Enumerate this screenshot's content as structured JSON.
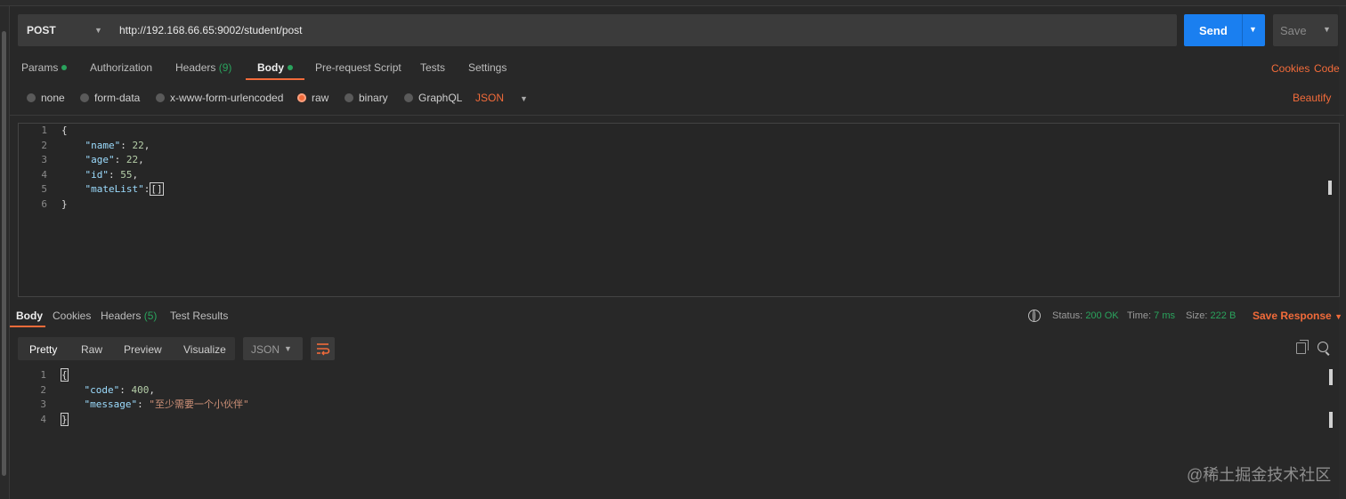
{
  "request": {
    "method": "POST",
    "url": "http://192.168.66.65:9002/student/post",
    "send_label": "Send",
    "save_label": "Save"
  },
  "request_tabs": [
    {
      "label": "Params",
      "dot": true
    },
    {
      "label": "Authorization"
    },
    {
      "label": "Headers",
      "count": "(9)"
    },
    {
      "label": "Body",
      "dot": true,
      "active": true
    },
    {
      "label": "Pre-request Script"
    },
    {
      "label": "Tests"
    },
    {
      "label": "Settings"
    }
  ],
  "links": {
    "cookies": "Cookies",
    "code": "Code",
    "beautify": "Beautify"
  },
  "body_types": [
    "none",
    "form-data",
    "x-www-form-urlencoded",
    "raw",
    "binary",
    "GraphQL"
  ],
  "body_type_selected": "raw",
  "body_format": "JSON",
  "request_body": {
    "line_numbers": [
      "1",
      "2",
      "3",
      "4",
      "5",
      "6"
    ],
    "keys": {
      "name": "\"name\"",
      "age": "\"age\"",
      "id": "\"id\"",
      "mateList": "\"mateList\""
    },
    "values": {
      "name": "22",
      "age": "22",
      "id": "55",
      "mateList": "[]"
    }
  },
  "response_tabs": [
    {
      "label": "Body",
      "active": true
    },
    {
      "label": "Cookies"
    },
    {
      "label": "Headers",
      "count": "(5)"
    },
    {
      "label": "Test Results"
    }
  ],
  "response_meta": {
    "status_label": "Status:",
    "status_value": "200 OK",
    "time_label": "Time:",
    "time_value": "7 ms",
    "size_label": "Size:",
    "size_value": "222 B",
    "save_response": "Save Response"
  },
  "view_modes": [
    "Pretty",
    "Raw",
    "Preview",
    "Visualize"
  ],
  "view_format": "JSON",
  "response_body": {
    "line_numbers": [
      "1",
      "2",
      "3",
      "4"
    ],
    "keys": {
      "code": "\"code\"",
      "message": "\"message\""
    },
    "values": {
      "code": "400",
      "message": "\"至少需要一个小伙伴\""
    }
  },
  "watermark": "@稀土掘金技术社区",
  "colors": {
    "accent": "#f26b3a",
    "send": "#1a7ff0",
    "ok": "#2aa35d",
    "background": "#282828"
  }
}
